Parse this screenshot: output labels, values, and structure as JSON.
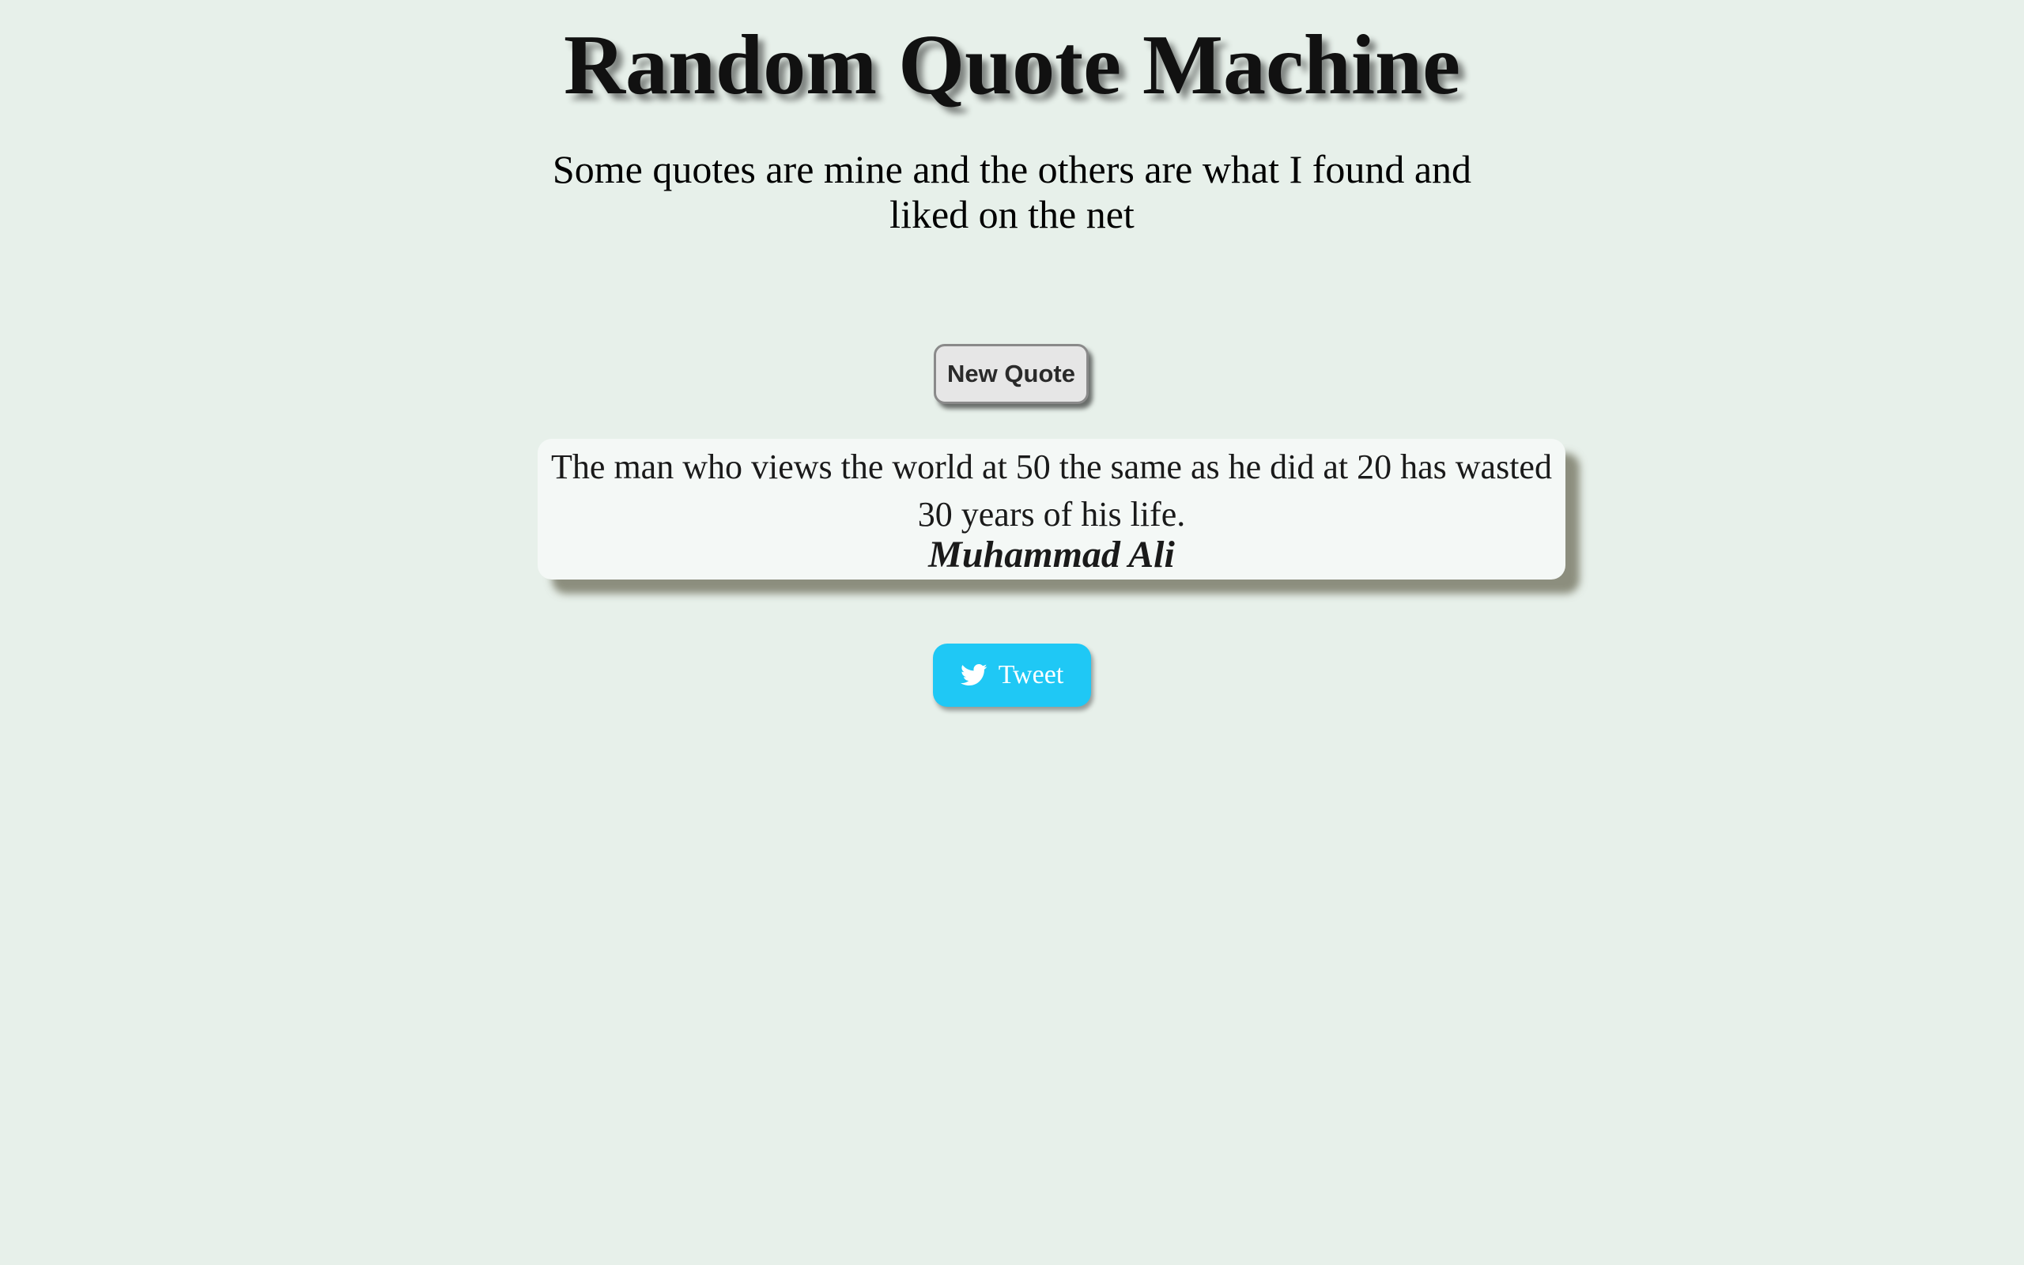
{
  "header": {
    "title": "Random Quote Machine",
    "subtitle": "Some quotes are mine and the others are what I found and liked on the net"
  },
  "controls": {
    "new_quote_label": "New Quote",
    "tweet_label": "Tweet",
    "tweet_icon": "twitter-bird-icon"
  },
  "quote": {
    "text": "The man who views the world at 50 the same as he did at 20 has wasted 30 years of his life.",
    "author": "Muhammad Ali"
  },
  "colors": {
    "background": "#e7f0ea",
    "tweet_button": "#1fc8f5",
    "quote_card": "#f4f8f6"
  }
}
